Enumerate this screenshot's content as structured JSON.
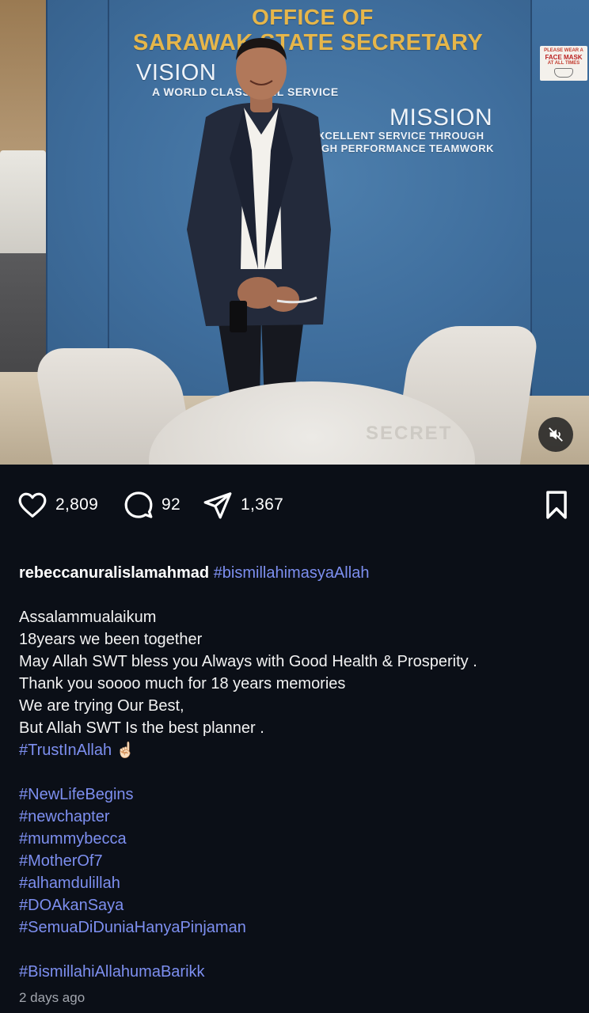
{
  "post": {
    "media": {
      "sign_title_line1": "OFFICE OF",
      "sign_title_line2": "SARAWAK STATE SECRETARY",
      "sign_vision": "VISION",
      "sign_vision_sub": "A WORLD CLASS CIVIL SERVICE",
      "sign_mission": "MISSION",
      "sign_mission_sub1": "EXCELLENT SERVICE THROUGH",
      "sign_mission_sub2": "HIGH PERFORMANCE TEAMWORK",
      "notice_line1": "PLEASE WEAR A",
      "notice_line2": "FACE MASK",
      "notice_line3": "AT ALL TIMES",
      "table_text": "SECRET",
      "mute_icon": "speaker-muted-icon"
    },
    "actions": {
      "likes": "2,809",
      "comments": "92",
      "shares": "1,367",
      "icons": [
        "heart-icon",
        "comment-icon",
        "share-icon",
        "bookmark-icon"
      ]
    },
    "caption": {
      "username": "rebeccanuralislamahmad",
      "username_tag": "#bismillahimasyaAllah",
      "lines": [
        "Assalammualaikum",
        "18years we been together",
        "May Allah SWT bless you Always with Good Health & Prosperity .",
        "Thank you soooo much for 18 years memories",
        "We are trying Our Best,",
        "But Allah SWT Is the best planner ."
      ],
      "trust_tag": "#TrustInAllah",
      "trust_emoji": "☝🏻",
      "tags": [
        "#NewLifeBegins",
        "#newchapter",
        "#mummybecca",
        "#MotherOf7",
        "#alhamdulillah",
        "#DOAkanSaya",
        "#SemuaDiDuniaHanyaPinjaman"
      ],
      "final_tag": "#BismillahiAllahumaBarikk"
    },
    "timestamp": "2 days ago"
  },
  "colors": {
    "background": "#0b0f17",
    "hashtag": "#7d8ff0",
    "text": "#f2f2f2",
    "muted": "#a2a6ae"
  }
}
